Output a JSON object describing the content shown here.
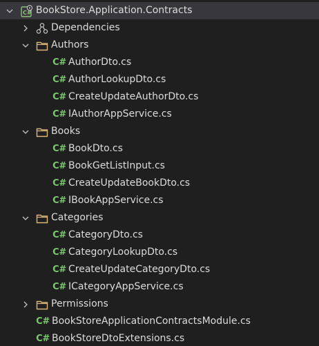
{
  "colors": {
    "background": "#1f1f1f",
    "selected_row": "#37373d",
    "text": "#dcdcdc",
    "folder": "#dcb67a",
    "csharp": "#7bc96f",
    "chevron": "#c5c5c5",
    "project_icon": "#8ec07c"
  },
  "tree": {
    "project": {
      "label": "BookStore.Application.Contracts",
      "expanded": true,
      "icon": "csharp-project-icon"
    },
    "dependencies": {
      "label": "Dependencies",
      "expanded": false,
      "icon": "dependencies-icon"
    },
    "authors": {
      "label": "Authors",
      "expanded": true,
      "files": [
        "AuthorDto.cs",
        "AuthorLookupDto.cs",
        "CreateUpdateAuthorDto.cs",
        "IAuthorAppService.cs"
      ]
    },
    "books": {
      "label": "Books",
      "expanded": true,
      "files": [
        "BookDto.cs",
        "BookGetListInput.cs",
        "CreateUpdateBookDto.cs",
        "IBookAppService.cs"
      ]
    },
    "categories": {
      "label": "Categories",
      "expanded": true,
      "files": [
        "CategoryDto.cs",
        "CategoryLookupDto.cs",
        "CreateUpdateCategoryDto.cs",
        "ICategoryAppService.cs"
      ]
    },
    "permissions": {
      "label": "Permissions",
      "expanded": false
    },
    "root_files": [
      "BookStoreApplicationContractsModule.cs",
      "BookStoreDtoExtensions.cs"
    ]
  },
  "csharp_icon_text": "C#"
}
